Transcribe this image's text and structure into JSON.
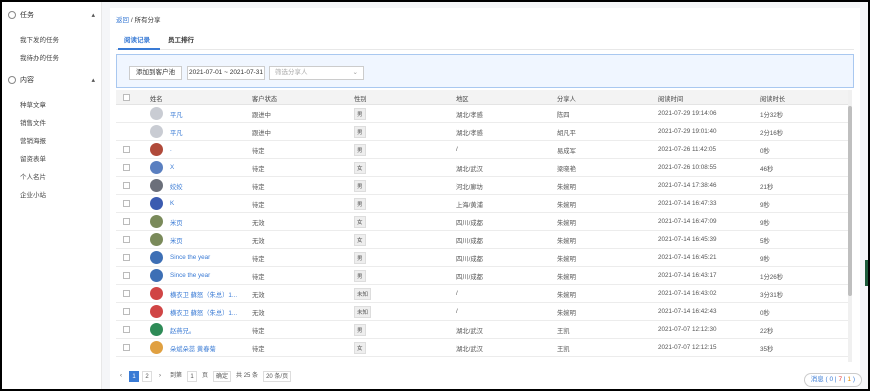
{
  "sidebar": {
    "groups": [
      {
        "label": "任务",
        "items": [
          "我下发的任务",
          "我待办的任务"
        ]
      },
      {
        "label": "内容",
        "items": [
          "种草文章",
          "销售文件",
          "营销海报",
          "留资表单",
          "个人名片",
          "企业小站"
        ]
      }
    ]
  },
  "breadcrumb": {
    "back": "返回",
    "sep": "/",
    "current": "所有分享"
  },
  "tabs": [
    "阅读记录",
    "员工排行"
  ],
  "filter": {
    "add_button": "添加到客户池",
    "date_range": "2021-07-01 ~ 2021-07-31",
    "sharer_placeholder": "筛选分享人",
    "caret": "⌄"
  },
  "table": {
    "columns": [
      "姓名",
      "客户状态",
      "性别",
      "地区",
      "分享人",
      "阅读时间",
      "阅读时长"
    ],
    "rows": [
      {
        "name": "平凡",
        "status": "跟进中",
        "gender": "男",
        "region": "湖北/孝感",
        "sharer": "陈四",
        "time": "2021-07-29 19:14:06",
        "duration": "1分32秒",
        "avatar": "#c9ccd3"
      },
      {
        "name": "平凡",
        "status": "跟进中",
        "gender": "男",
        "region": "湖北/孝感",
        "sharer": "胡凡平",
        "time": "2021-07-29 19:01:40",
        "duration": "2分16秒",
        "avatar": "#c9ccd3"
      },
      {
        "name": ".",
        "status": "待定",
        "gender": "男",
        "region": "/",
        "sharer": "易成军",
        "time": "2021-07-26 11:42:05",
        "duration": "0秒",
        "avatar": "#b04a3a"
      },
      {
        "name": "X",
        "status": "待定",
        "gender": "女",
        "region": "湖北/武汉",
        "sharer": "梁晓艳",
        "time": "2021-07-26 10:08:55",
        "duration": "46秒",
        "avatar": "#5a7fc0"
      },
      {
        "name": "姣姣",
        "status": "待定",
        "gender": "男",
        "region": "河北/廊坊",
        "sharer": "朱婉明",
        "time": "2021-07-14 17:38:46",
        "duration": "21秒",
        "avatar": "#6b6f7a"
      },
      {
        "name": "K",
        "status": "待定",
        "gender": "男",
        "region": "上海/黄浦",
        "sharer": "朱婉明",
        "time": "2021-07-14 16:47:33",
        "duration": "9秒",
        "avatar": "#3b5bb0"
      },
      {
        "name": "米页",
        "status": "无效",
        "gender": "女",
        "region": "四川/成都",
        "sharer": "朱婉明",
        "time": "2021-07-14 16:47:09",
        "duration": "9秒",
        "avatar": "#7a8a5a"
      },
      {
        "name": "米页",
        "status": "无效",
        "gender": "女",
        "region": "四川/成都",
        "sharer": "朱婉明",
        "time": "2021-07-14 16:45:39",
        "duration": "5秒",
        "avatar": "#7a8a5a"
      },
      {
        "name": "Since the year",
        "status": "待定",
        "gender": "男",
        "region": "四川/成都",
        "sharer": "朱婉明",
        "time": "2021-07-14 16:45:21",
        "duration": "9秒",
        "avatar": "#3d6fb5"
      },
      {
        "name": "Since the year",
        "status": "待定",
        "gender": "男",
        "region": "四川/成都",
        "sharer": "朱婉明",
        "time": "2021-07-14 16:43:17",
        "duration": "1分26秒",
        "avatar": "#3d6fb5"
      },
      {
        "name": "横衣卫 蘇怒（朱总）1...",
        "status": "无效",
        "gender": "未知",
        "region": "/",
        "sharer": "朱婉明",
        "time": "2021-07-14 16:43:02",
        "duration": "3分31秒",
        "avatar": "#d04545"
      },
      {
        "name": "横衣卫 蘇怒（朱总）1...",
        "status": "无效",
        "gender": "未知",
        "region": "/",
        "sharer": "朱婉明",
        "time": "2021-07-14 16:42:43",
        "duration": "0秒",
        "avatar": "#d04545"
      },
      {
        "name": "赵燕兄。",
        "status": "待定",
        "gender": "男",
        "region": "湖北/武汉",
        "sharer": "王凯",
        "time": "2021-07-07 12:12:30",
        "duration": "22秒",
        "avatar": "#2e8b57"
      },
      {
        "name": "朵斌朵蕊 黄春菊",
        "status": "待定",
        "gender": "女",
        "region": "湖北/武汉",
        "sharer": "王凯",
        "time": "2021-07-07 12:12:15",
        "duration": "35秒",
        "avatar": "#e0a040"
      }
    ]
  },
  "pagination": {
    "prev": "‹",
    "pages": [
      "1",
      "2"
    ],
    "next": "›",
    "goto_label": "到第",
    "goto_value": "1",
    "page_suffix": "页",
    "confirm": "确定",
    "total": "共 25 条",
    "page_size": "20 条/页"
  },
  "message": {
    "label": "消息",
    "sep1": "(",
    "count_a": "0",
    "sep2": "|",
    "count_b": "7",
    "sep3": "|",
    "count_c": "1",
    "sep4": ")"
  }
}
